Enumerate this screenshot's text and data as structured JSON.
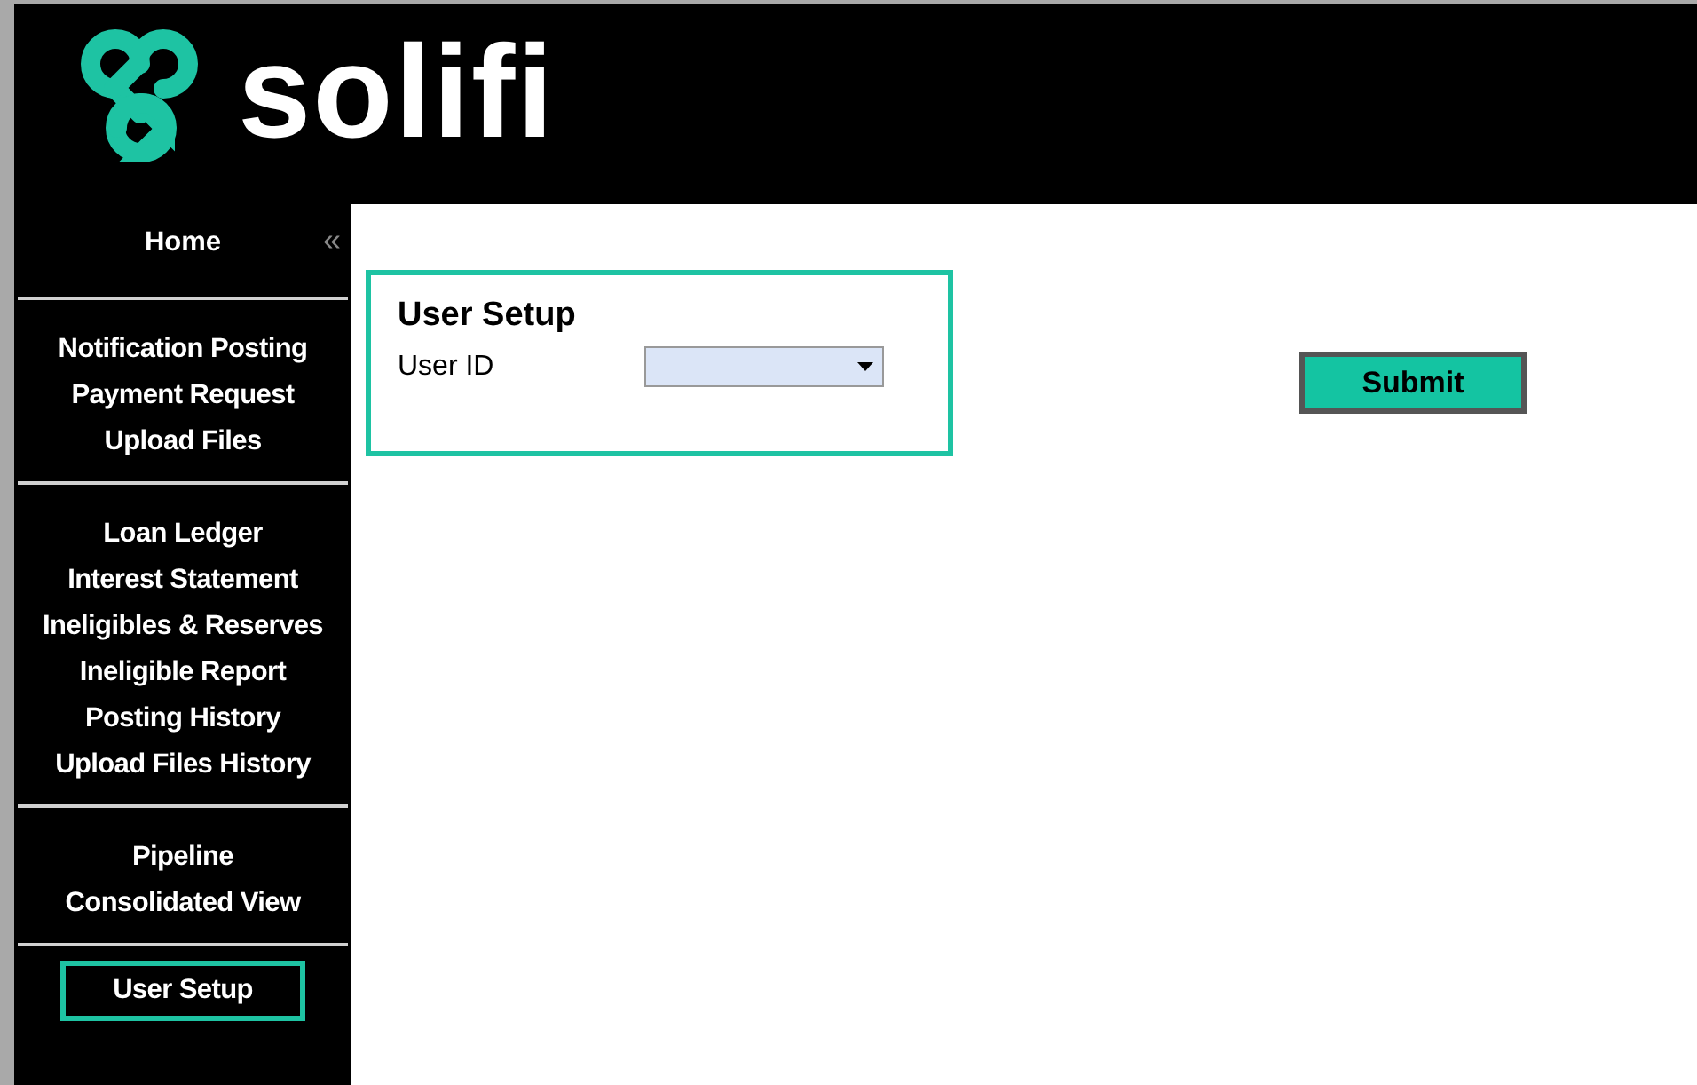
{
  "header": {
    "brand": "solifi"
  },
  "sidebar": {
    "home": "Home",
    "collapse": "«",
    "groups": [
      [
        {
          "label": "Notification Posting",
          "selected": false
        },
        {
          "label": "Payment Request",
          "selected": false
        },
        {
          "label": "Upload Files",
          "selected": false
        }
      ],
      [
        {
          "label": "Loan Ledger",
          "selected": false
        },
        {
          "label": "Interest Statement",
          "selected": false
        },
        {
          "label": "Ineligibles & Reserves",
          "selected": false
        },
        {
          "label": "Ineligible Report",
          "selected": false
        },
        {
          "label": "Posting History",
          "selected": false
        },
        {
          "label": "Upload Files History",
          "selected": false
        }
      ],
      [
        {
          "label": "Pipeline",
          "selected": false
        },
        {
          "label": "Consolidated View",
          "selected": false
        }
      ],
      [
        {
          "label": "User Setup",
          "selected": true
        }
      ]
    ]
  },
  "form": {
    "title": "User Setup",
    "field_label": "User ID",
    "submit": "Submit"
  }
}
